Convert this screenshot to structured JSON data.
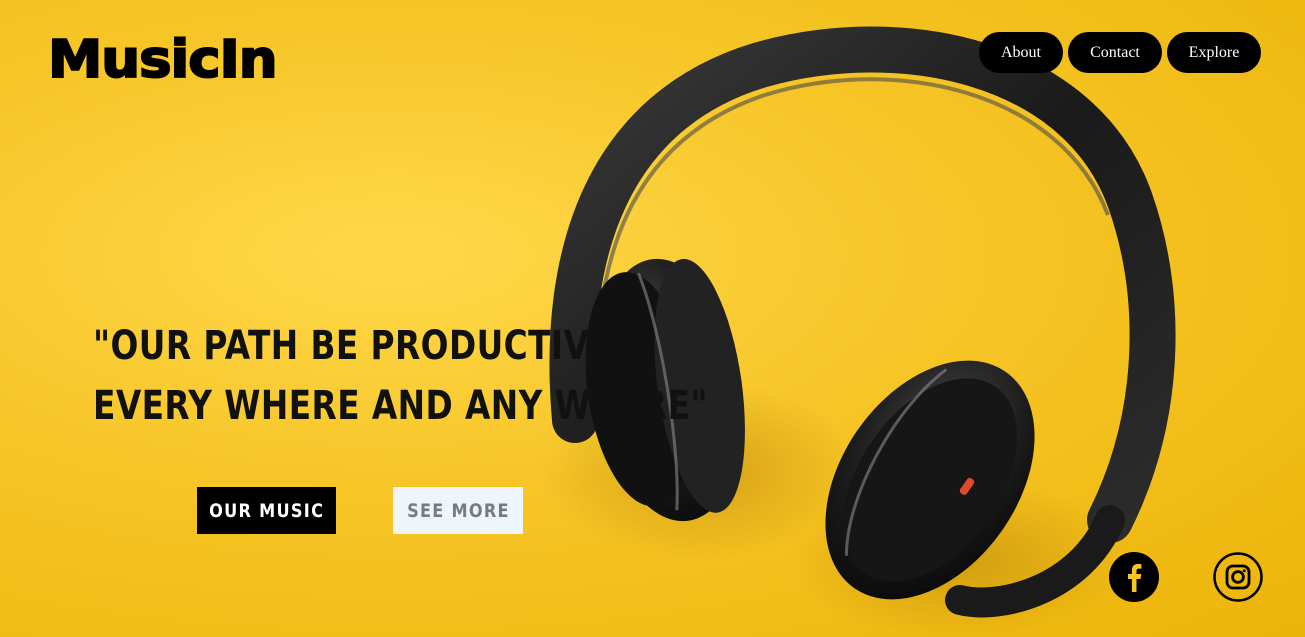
{
  "brand": {
    "logo_text": "MusicIn"
  },
  "nav": {
    "items": [
      {
        "label": "About"
      },
      {
        "label": "Contact"
      },
      {
        "label": "Explore"
      }
    ]
  },
  "hero": {
    "quote_line1": "\"OUR PATH BE PRODUCTIVE",
    "quote_line2": "EVERY WHERE AND ANY WHERE\"",
    "primary_button": "OUR MUSIC",
    "secondary_button": "SEE MORE",
    "background_image": "headphones-on-yellow-background"
  },
  "social": {
    "facebook_icon": "facebook-icon",
    "instagram_icon": "instagram-icon"
  },
  "colors": {
    "background": "#f6c526",
    "nav_bg": "#000000",
    "nav_text": "#ffffff",
    "primary_btn_bg": "#000000",
    "secondary_btn_bg": "#eef6fb",
    "secondary_btn_text": "#7a7a7a"
  }
}
